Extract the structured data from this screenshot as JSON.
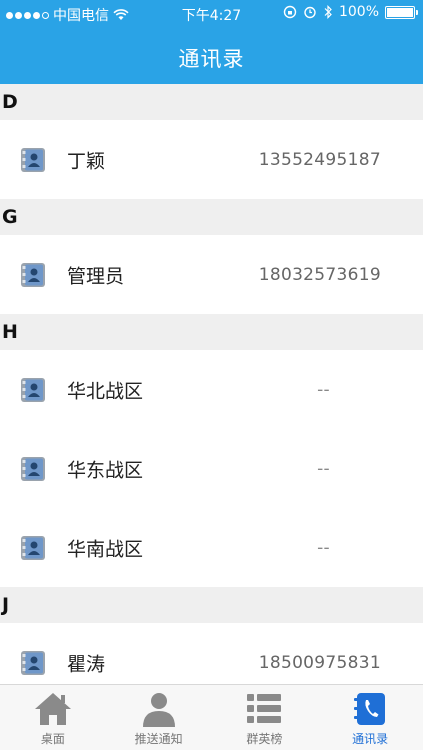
{
  "status_bar": {
    "carrier": "中国电信",
    "time": "下午4:27",
    "battery": "100%"
  },
  "nav": {
    "title": "通讯录"
  },
  "sections": [
    {
      "letter": "D",
      "contacts": [
        {
          "name": "丁颖",
          "phone": "13552495187"
        }
      ]
    },
    {
      "letter": "G",
      "contacts": [
        {
          "name": "管理员",
          "phone": "18032573619"
        }
      ]
    },
    {
      "letter": "H",
      "contacts": [
        {
          "name": "华北战区",
          "phone": "--"
        },
        {
          "name": "华东战区",
          "phone": "--"
        },
        {
          "name": "华南战区",
          "phone": "--"
        }
      ]
    },
    {
      "letter": "J",
      "contacts": [
        {
          "name": "瞿涛",
          "phone": "18500975831"
        }
      ]
    }
  ],
  "tabs": [
    {
      "label": "桌面",
      "icon": "home-icon"
    },
    {
      "label": "推送通知",
      "icon": "person-icon"
    },
    {
      "label": "群英榜",
      "icon": "list-icon"
    },
    {
      "label": "通讯录",
      "icon": "phonebook-icon",
      "active": true
    }
  ],
  "colors": {
    "accent": "#2aa3e6",
    "active_tab": "#1f6fd6",
    "section_bg": "#efefef"
  }
}
